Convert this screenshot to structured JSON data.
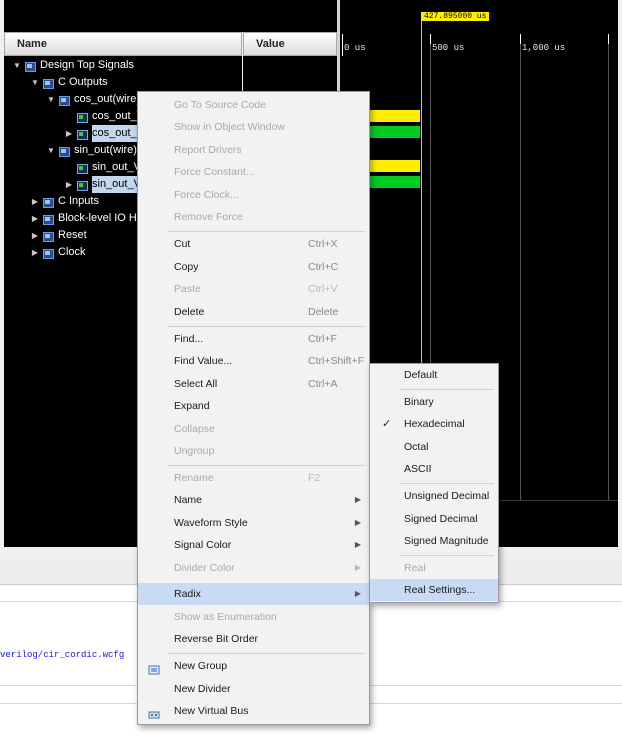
{
  "wave": {
    "name_header": "Name",
    "value_header": "Value",
    "cursor_time": "427.895000 us",
    "ruler_labels": [
      "0 us",
      "500 us",
      "1,000 us"
    ]
  },
  "tree": {
    "items": [
      {
        "label": "Design Top Signals",
        "expanded": true,
        "kind": "group"
      },
      {
        "label": "C Outputs",
        "expanded": true,
        "kind": "group"
      },
      {
        "label": "cos_out(wire)",
        "expanded": true,
        "kind": "group"
      },
      {
        "label": "cos_out_V",
        "kind": "signal"
      },
      {
        "label": "cos_out_V",
        "kind": "signal",
        "selected": true
      },
      {
        "label": "sin_out(wire)",
        "expanded": true,
        "kind": "group"
      },
      {
        "label": "sin_out_V",
        "kind": "signal"
      },
      {
        "label": "sin_out_V",
        "kind": "signal",
        "selected": true
      },
      {
        "label": "C Inputs",
        "expanded": false,
        "kind": "group"
      },
      {
        "label": "Block-level IO Han",
        "expanded": false,
        "kind": "group"
      },
      {
        "label": "Reset",
        "expanded": false,
        "kind": "group"
      },
      {
        "label": "Clock",
        "expanded": false,
        "kind": "group"
      }
    ]
  },
  "console": {
    "path": "verilog/cir_cordic.wcfg"
  },
  "context_menu": {
    "items": [
      {
        "label": "Go To Source Code",
        "enabled": false
      },
      {
        "label": "Show in Object Window",
        "enabled": false
      },
      {
        "label": "Report Drivers",
        "enabled": false
      },
      {
        "label": "Force Constant...",
        "enabled": false
      },
      {
        "label": "Force Clock...",
        "enabled": false
      },
      {
        "label": "Remove Force",
        "enabled": false
      },
      {
        "label": "Cut",
        "shortcut": "Ctrl+X",
        "enabled": true
      },
      {
        "label": "Copy",
        "shortcut": "Ctrl+C",
        "enabled": true
      },
      {
        "label": "Paste",
        "shortcut": "Ctrl+V",
        "enabled": false
      },
      {
        "label": "Delete",
        "shortcut": "Delete",
        "enabled": true
      },
      {
        "label": "Find...",
        "shortcut": "Ctrl+F",
        "enabled": true
      },
      {
        "label": "Find Value...",
        "shortcut": "Ctrl+Shift+F",
        "enabled": true
      },
      {
        "label": "Select All",
        "shortcut": "Ctrl+A",
        "enabled": true
      },
      {
        "label": "Expand",
        "enabled": true
      },
      {
        "label": "Collapse",
        "enabled": false
      },
      {
        "label": "Ungroup",
        "enabled": false
      },
      {
        "label": "Rename",
        "shortcut": "F2",
        "enabled": false
      },
      {
        "label": "Name",
        "submenu": true,
        "enabled": true
      },
      {
        "label": "Waveform Style",
        "submenu": true,
        "enabled": true
      },
      {
        "label": "Signal Color",
        "submenu": true,
        "enabled": true
      },
      {
        "label": "Divider Color",
        "submenu": true,
        "enabled": false
      },
      {
        "label": "Radix",
        "submenu": true,
        "enabled": true,
        "highlighted": true
      },
      {
        "label": "Show as Enumeration",
        "enabled": false
      },
      {
        "label": "Reverse Bit Order",
        "enabled": true
      },
      {
        "label": "New Group",
        "enabled": true,
        "icon": "new-group-icon"
      },
      {
        "label": "New Divider",
        "enabled": true
      },
      {
        "label": "New Virtual Bus",
        "enabled": true,
        "icon": "virtual-bus-icon"
      }
    ]
  },
  "radix_menu": {
    "items": [
      {
        "label": "Default",
        "enabled": true
      },
      {
        "label": "Binary",
        "enabled": true
      },
      {
        "label": "Hexadecimal",
        "enabled": true,
        "checked": true
      },
      {
        "label": "Octal",
        "enabled": true
      },
      {
        "label": "ASCII",
        "enabled": true
      },
      {
        "label": "Unsigned Decimal",
        "enabled": true
      },
      {
        "label": "Signed Decimal",
        "enabled": true
      },
      {
        "label": "Signed Magnitude",
        "enabled": true
      },
      {
        "label": "Real",
        "enabled": false
      },
      {
        "label": "Real Settings...",
        "enabled": true,
        "highlighted": true
      }
    ],
    "check_mark": "✓"
  },
  "colors": {
    "signal_yellow": "#ffee00",
    "signal_green": "#00cc22",
    "cursor_line": "#d9c94a",
    "menu_highlight": "#c8daf4"
  }
}
